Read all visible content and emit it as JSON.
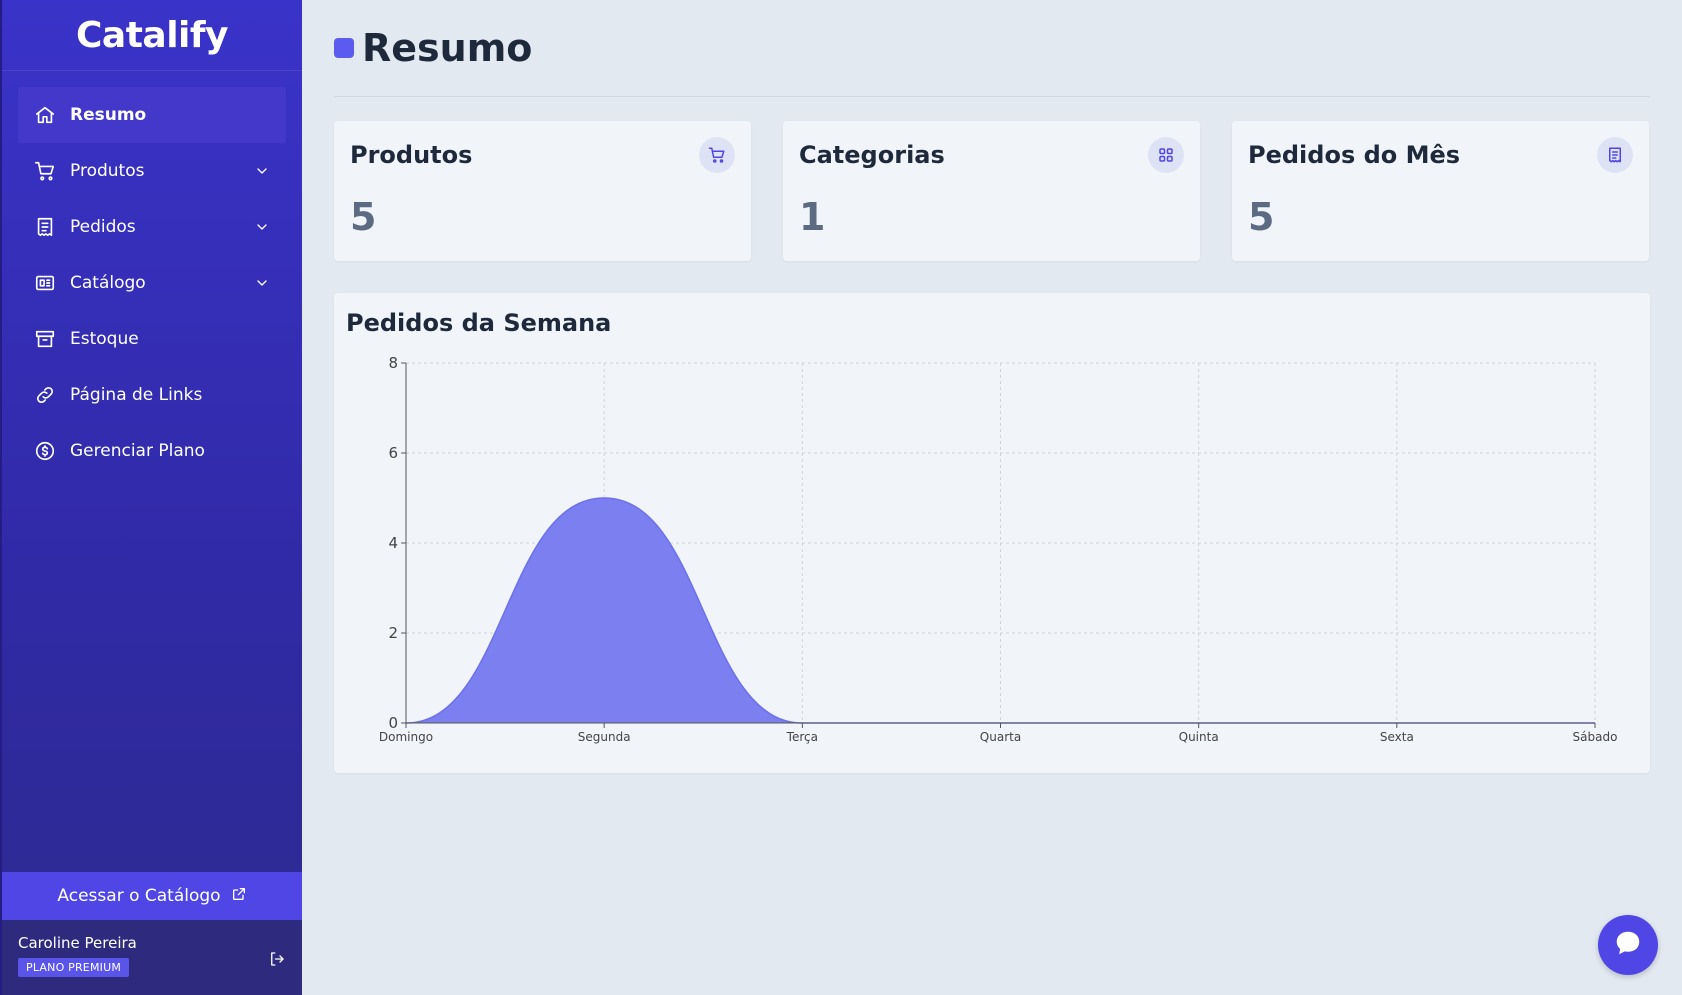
{
  "sidebar": {
    "logo": "Catalify",
    "nav": [
      {
        "label": "Resumo",
        "icon": "home-icon",
        "active": true,
        "dropdown": false
      },
      {
        "label": "Produtos",
        "icon": "cart-icon",
        "active": false,
        "dropdown": true
      },
      {
        "label": "Pedidos",
        "icon": "receipt-icon",
        "active": false,
        "dropdown": true
      },
      {
        "label": "Catálogo",
        "icon": "catalog-icon",
        "active": false,
        "dropdown": true
      },
      {
        "label": "Estoque",
        "icon": "archive-icon",
        "active": false,
        "dropdown": false
      },
      {
        "label": "Página de Links",
        "icon": "link-icon",
        "active": false,
        "dropdown": false
      },
      {
        "label": "Gerenciar Plano",
        "icon": "dollar-circle-icon",
        "active": false,
        "dropdown": false
      }
    ],
    "access_button": "Acessar o Catálogo",
    "user": {
      "name": "Caroline Pereira",
      "plan": "PLANO PREMIUM"
    }
  },
  "main": {
    "title": "Resumo",
    "cards": [
      {
        "title": "Produtos",
        "value": "5",
        "icon": "cart-icon"
      },
      {
        "title": "Categorias",
        "value": "1",
        "icon": "grid-icon"
      },
      {
        "title": "Pedidos do Mês",
        "value": "5",
        "icon": "receipt-icon"
      }
    ],
    "chart_title": "Pedidos da Semana"
  },
  "colors": {
    "accent": "#4f46e5",
    "area_fill": "#7b7ff0",
    "sidebar": "#3a33c9",
    "background": "#e3e9f1"
  },
  "chart_data": {
    "type": "area",
    "title": "Pedidos da Semana",
    "categories": [
      "Domingo",
      "Segunda",
      "Terça",
      "Quarta",
      "Quinta",
      "Sexta",
      "Sábado"
    ],
    "values": [
      0,
      5,
      0,
      0,
      0,
      0,
      0
    ],
    "ylim": [
      0,
      8
    ],
    "yticks": [
      0,
      2,
      4,
      6,
      8
    ],
    "grid": true,
    "curve": "smooth"
  }
}
